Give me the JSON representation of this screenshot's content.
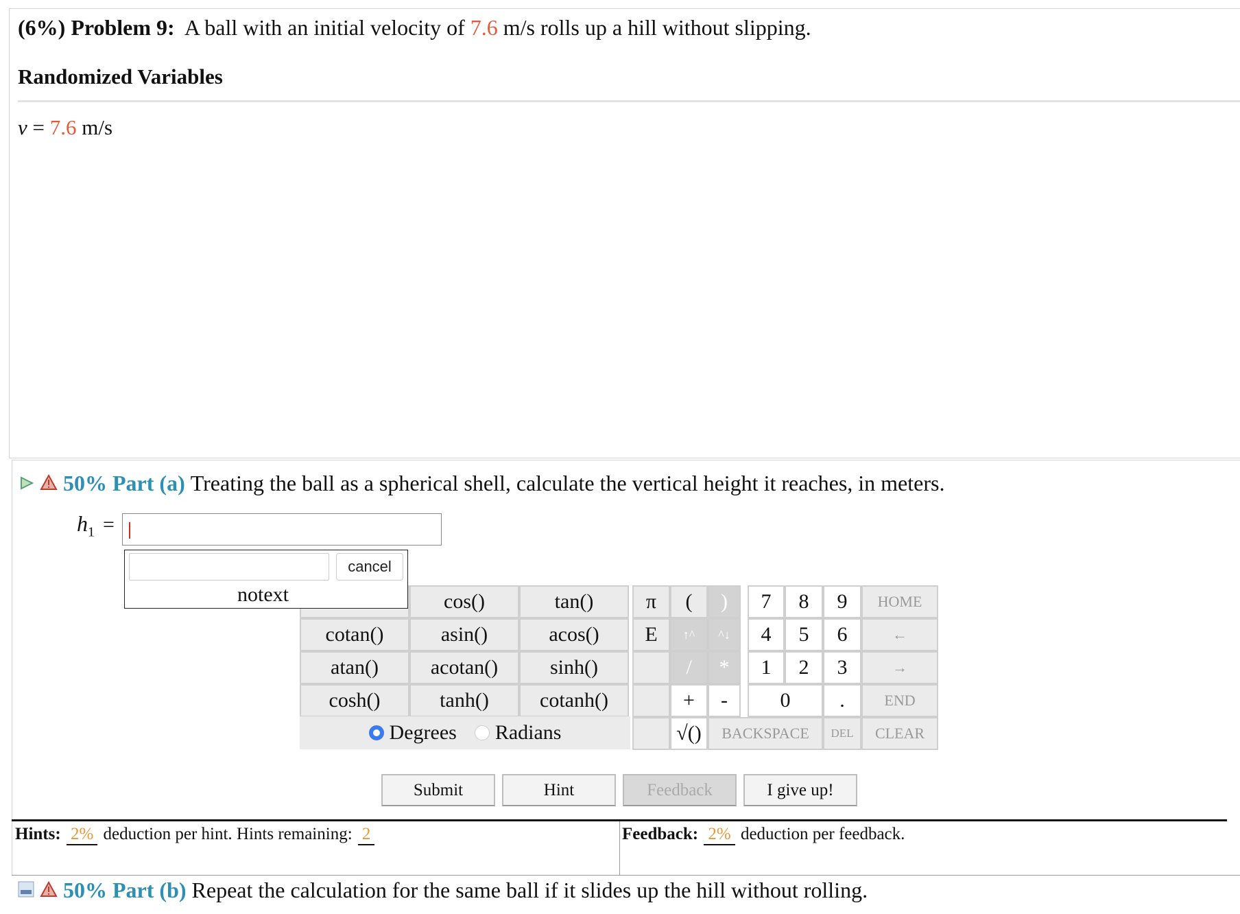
{
  "problem": {
    "weight": "(6%)",
    "label": "Problem 9:",
    "text_before": "A ball with an initial velocity of",
    "velocity_value": "7.6",
    "text_after": "m/s rolls up a hill without slipping."
  },
  "randomized_variables": {
    "heading": "Randomized Variables",
    "var_name": "v",
    "eq": " = ",
    "value": "7.6",
    "unit": " m/s"
  },
  "part_a": {
    "percent": "50%",
    "label": "Part (a)",
    "text": "Treating the ball as a spherical shell, calculate the vertical height it reaches, in meters.",
    "variable": "h",
    "subscript": "1",
    "equals": "=",
    "answer": ""
  },
  "popup": {
    "cancel_label": "cancel",
    "notext": "notext"
  },
  "calculator": {
    "functions": {
      "cos": "cos()",
      "tan": "tan()",
      "cotan": "cotan()",
      "asin": "asin()",
      "acos": "acos()",
      "atan": "atan()",
      "acotan": "acotan()",
      "sinh": "sinh()",
      "cosh": "cosh()",
      "tanh": "tanh()",
      "cotanh": "cotanh()"
    },
    "degrees_label": "Degrees",
    "radians_label": "Radians",
    "keys": {
      "pi": "π",
      "lparen": "(",
      "rparen": ")",
      "e": "E",
      "up": "↑^",
      "down": "^↓",
      "slash": "/",
      "star": "*",
      "plus": "+",
      "minus": "-",
      "dot": ".",
      "sqrt": "√()",
      "n7": "7",
      "n8": "8",
      "n9": "9",
      "n4": "4",
      "n5": "5",
      "n6": "6",
      "n1": "1",
      "n2": "2",
      "n3": "3",
      "n0": "0",
      "home": "HOME",
      "left": "←",
      "right": "→",
      "end": "END",
      "backspace": "BACKSPACE",
      "del": "DEL",
      "clear": "CLEAR"
    }
  },
  "actions": {
    "submit": "Submit",
    "hint": "Hint",
    "feedback": "Feedback",
    "give_up": "I give up!"
  },
  "hints": {
    "label": "Hints:",
    "deduction": "2%",
    "text": "deduction per hint. Hints remaining:",
    "remaining": "2"
  },
  "feedback": {
    "label": "Feedback:",
    "deduction": "2%",
    "text": "deduction per feedback."
  },
  "part_b": {
    "percent": "50%",
    "label": "Part (b)",
    "text": "Repeat the calculation for the same ball if it slides up the hill without rolling."
  },
  "colors": {
    "value_red": "#e25b3c",
    "part_teal": "#2e8fb5",
    "deduction_orange": "#e8983a",
    "radio_blue": "#3a7bf0"
  }
}
